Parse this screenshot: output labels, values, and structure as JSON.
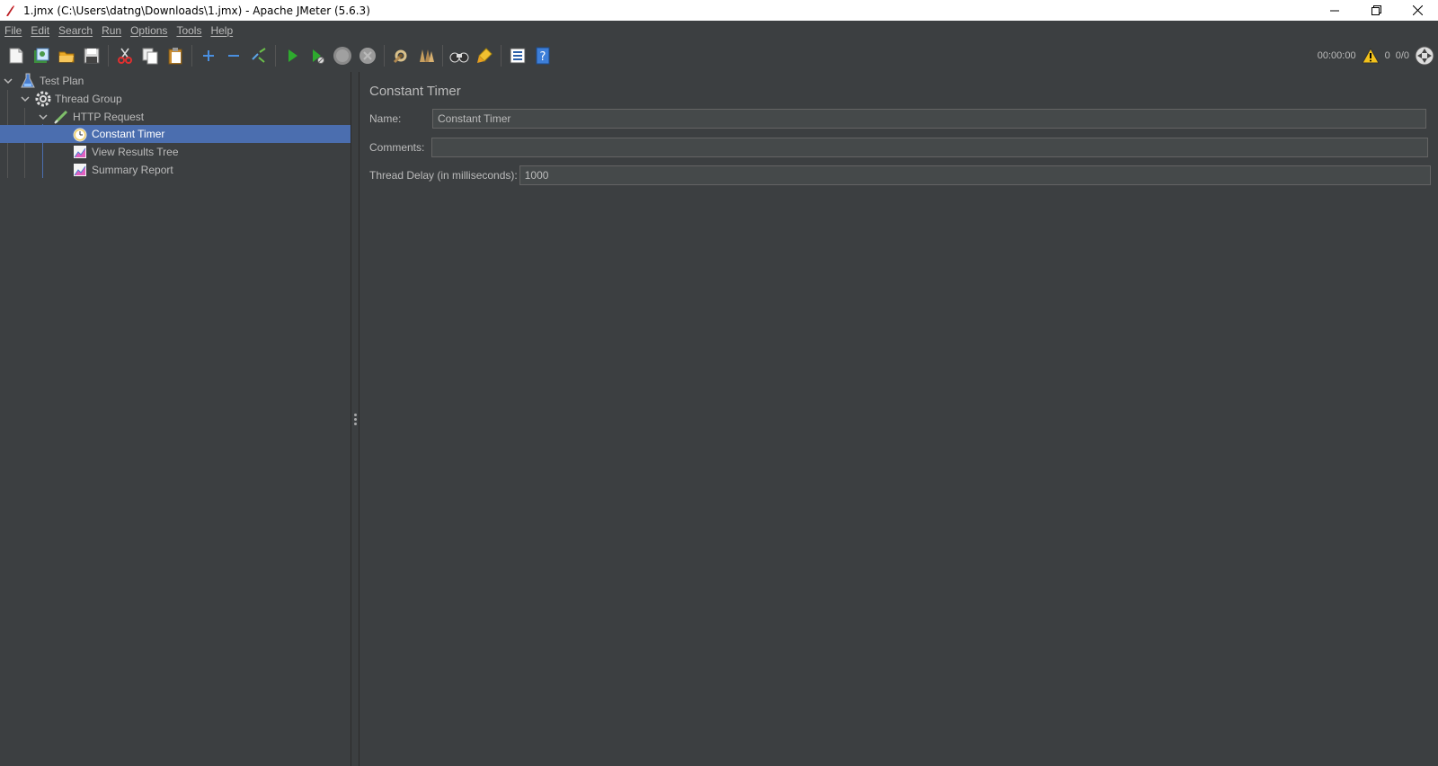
{
  "window": {
    "title": "1.jmx (C:\\Users\\datng\\Downloads\\1.jmx) - Apache JMeter (5.6.3)"
  },
  "menu": {
    "items": [
      "File",
      "Edit",
      "Search",
      "Run",
      "Options",
      "Tools",
      "Help"
    ]
  },
  "toolbar": {
    "icons": [
      "new-icon",
      "templates-icon",
      "open-icon",
      "save-icon",
      "cut-icon",
      "copy-icon",
      "paste-icon",
      "expand-icon",
      "collapse-icon",
      "toggle-icon",
      "start-icon",
      "start-no-pauses-icon",
      "stop-icon",
      "shutdown-icon",
      "clear-icon",
      "clear-all-icon",
      "search-icon",
      "reset-search-icon",
      "function-helper-icon",
      "help-icon"
    ],
    "timer": "00:00:00",
    "warning_count": "0",
    "threads": "0/0"
  },
  "tree": {
    "items": [
      {
        "label": "Test Plan"
      },
      {
        "label": "Thread Group"
      },
      {
        "label": "HTTP Request"
      },
      {
        "label": "Constant Timer"
      },
      {
        "label": "View Results Tree"
      },
      {
        "label": "Summary Report"
      }
    ]
  },
  "panel": {
    "title": "Constant Timer",
    "name_label": "Name:",
    "name_value": "Constant Timer",
    "comments_label": "Comments:",
    "comments_value": "",
    "delay_label": "Thread Delay (in milliseconds):",
    "delay_value": "1000"
  },
  "colors": {
    "background": "#3c3f41",
    "selection": "#4b6eaf",
    "text": "#bbbbbb"
  }
}
